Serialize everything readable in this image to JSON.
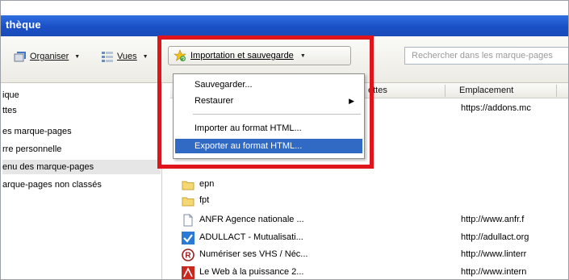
{
  "window": {
    "title": "thèque"
  },
  "toolbar": {
    "organize": {
      "label": "Organiser"
    },
    "views": {
      "label": "Vues"
    },
    "import_backup": {
      "label": "Importation et sauvegarde"
    },
    "search": {
      "placeholder": "Rechercher dans les marque-pages"
    }
  },
  "left_pane": {
    "items": [
      {
        "label": "ique"
      },
      {
        "label": "ttes"
      },
      {
        "label": "es marque-pages"
      },
      {
        "label": "rre personnelle"
      },
      {
        "label": "enu des marque-pages",
        "selected": true
      },
      {
        "label": "arque-pages non classés"
      }
    ]
  },
  "columns": {
    "tags": "ettes",
    "location": "Emplacement"
  },
  "list": {
    "rows": [
      {
        "name": "",
        "location": "https://addons.mc",
        "icon": "none"
      },
      {
        "name": "epn",
        "location": "",
        "icon": "folder-icon"
      },
      {
        "name": "fpt",
        "location": "",
        "icon": "folder-icon"
      },
      {
        "name": "ANFR Agence nationale ...",
        "location": "http://www.anfr.f",
        "icon": "page-icon"
      },
      {
        "name": "ADULLACT - Mutualisati...",
        "location": "http://adullact.org",
        "icon": "check-icon"
      },
      {
        "name": "Numériser ses VHS / Néc...",
        "location": "http://www.linterr",
        "icon": "r-logo-icon"
      },
      {
        "name": "Le Web à la puissance 2...",
        "location": "http://www.intern",
        "icon": "red-logo-icon"
      }
    ]
  },
  "menu": {
    "items": [
      {
        "label": "Sauvegarder..."
      },
      {
        "label": "Restaurer",
        "has_submenu": true
      },
      {
        "label": "Importer au format HTML..."
      },
      {
        "label": "Exporter au format HTML...",
        "highlighted": true
      }
    ]
  },
  "colors": {
    "titlebar": "#1a4fc6",
    "highlight_box": "#e0141b",
    "menu_highlight": "#316ac5"
  }
}
